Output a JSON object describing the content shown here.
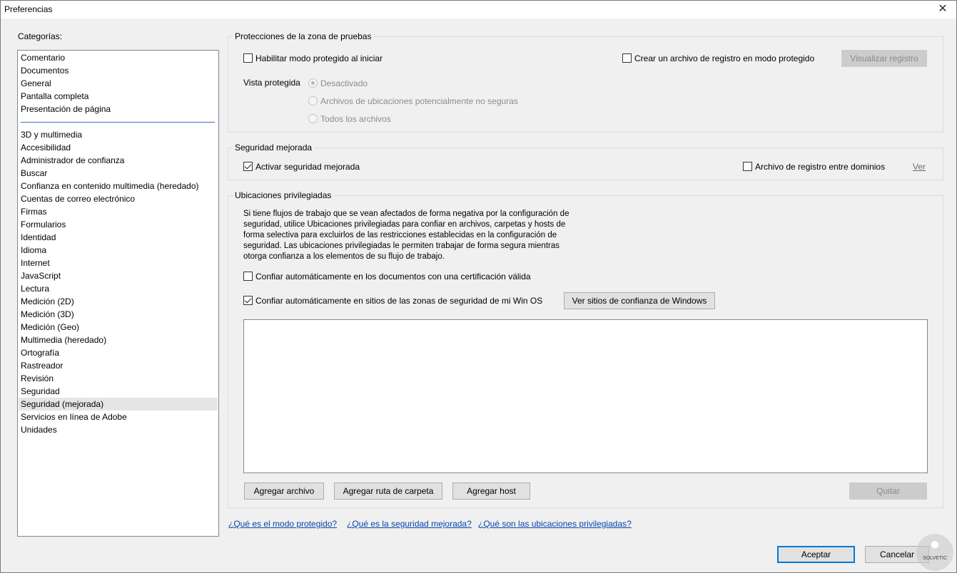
{
  "window": {
    "title": "Preferencias",
    "close_glyph": "✕"
  },
  "sidebar": {
    "label": "Categorías:",
    "top_items": [
      "Comentario",
      "Documentos",
      "General",
      "Pantalla completa",
      "Presentación de página"
    ],
    "items": [
      "3D y multimedia",
      "Accesibilidad",
      "Administrador de confianza",
      "Buscar",
      "Confianza en contenido multimedia (heredado)",
      "Cuentas de correo electrónico",
      "Firmas",
      "Formularios",
      "Identidad",
      "Idioma",
      "Internet",
      "JavaScript",
      "Lectura",
      "Medición (2D)",
      "Medición (3D)",
      "Medición (Geo)",
      "Multimedia (heredado)",
      "Ortografía",
      "Rastreador",
      "Revisión",
      "Seguridad",
      "Seguridad (mejorada)",
      "Servicios en línea de Adobe",
      "Unidades"
    ],
    "selected": "Seguridad (mejorada)"
  },
  "sandbox": {
    "title": "Protecciones de la zona de pruebas",
    "enable_protected_mode": {
      "label": "Habilitar modo protegido al iniciar",
      "checked": false
    },
    "create_log": {
      "label": "Crear un archivo de registro en modo protegido",
      "checked": false
    },
    "view_log_button": "Visualizar registro",
    "protected_view_label": "Vista protegida",
    "protected_view_options": [
      "Desactivado",
      "Archivos de ubicaciones potencialmente no seguras",
      "Todos los archivos"
    ],
    "protected_view_selected": "Desactivado"
  },
  "enhanced": {
    "title": "Seguridad mejorada",
    "activate": {
      "label": "Activar seguridad mejorada",
      "checked": true
    },
    "cross_domain_log": {
      "label": "Archivo de registro entre dominios",
      "checked": false
    },
    "view_link": "Ver"
  },
  "privileged": {
    "title": "Ubicaciones privilegiadas",
    "description": [
      "Si tiene flujos de trabajo que se vean afectados de forma negativa por la configuración de",
      "seguridad, utilice Ubicaciones privilegiadas para confiar en archivos, carpetas y hosts de",
      "forma selectiva para excluirlos de las restricciones establecidas en la configuración de",
      "seguridad. Las ubicaciones privilegiadas le permiten trabajar de forma segura mientras",
      "otorga confianza a los elementos de su flujo de trabajo."
    ],
    "trust_certified": {
      "label": "Confiar automáticamente en los documentos con una certificación válida",
      "checked": false
    },
    "trust_win_zones": {
      "label": "Confiar automáticamente en sitios de las zonas de seguridad de mi Win OS",
      "checked": true
    },
    "view_windows_sites_button": "Ver sitios de confianza de Windows",
    "add_file_button": "Agregar archivo",
    "add_folder_button": "Agregar ruta de carpeta",
    "add_host_button": "Agregar host",
    "remove_button": "Quitar"
  },
  "help_links": [
    "¿Qué es el modo protegido?",
    "¿Qué es la seguridad mejorada?",
    "¿Qué son las ubicaciones privilegiadas?"
  ],
  "footer": {
    "ok_button": "Aceptar",
    "cancel_button": "Cancelar"
  },
  "watermark": {
    "text": "SOLVETIC"
  },
  "colors": {
    "accent": "#0078d7",
    "link": "#0645ad",
    "selection": "#e5e5e5",
    "separator": "#3f6fb5"
  }
}
